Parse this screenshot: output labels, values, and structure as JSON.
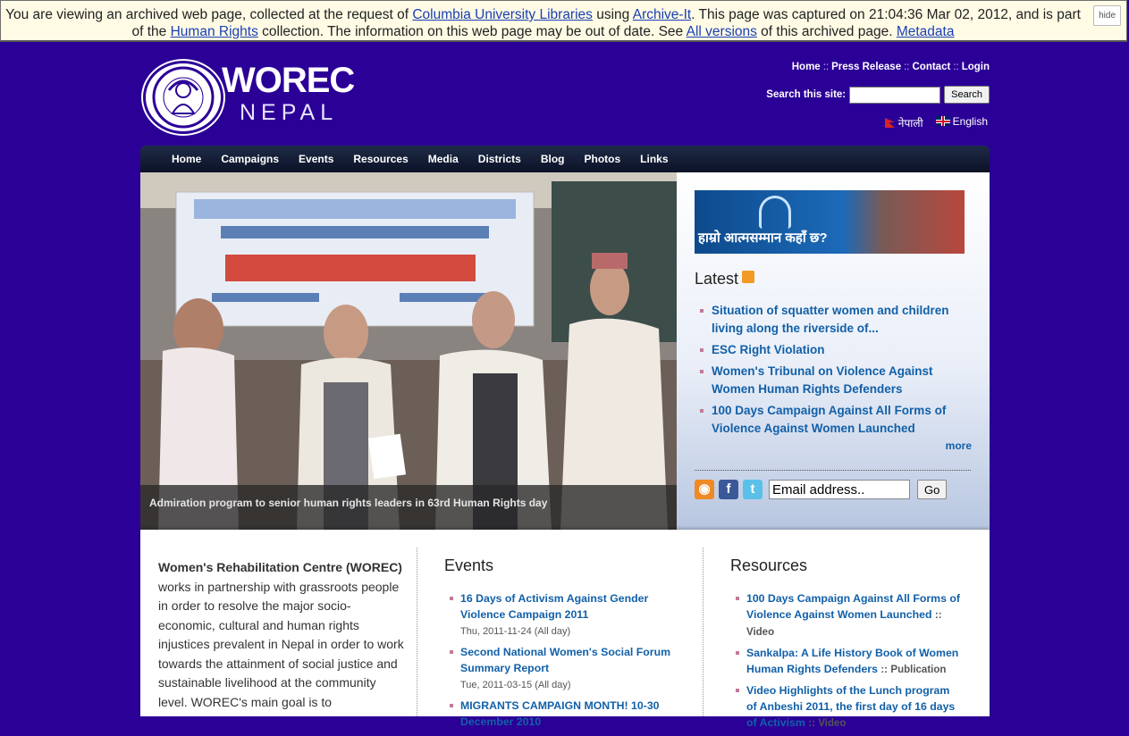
{
  "archive_bar": {
    "t1": "You are viewing an archived web page, collected at the request of ",
    "link1": "Columbia University Libraries",
    "t2": " using ",
    "link2": "Archive-It",
    "t3": ". This page was captured on 21:04:36 Mar 02, 2012, and is part",
    "t4": "of the ",
    "link3": "Human Rights",
    "t5": " collection. The information on this web page may be out of date. See ",
    "link4": "All versions",
    "t6": " of this archived page. ",
    "link5": "Metadata",
    "hide": "hide"
  },
  "logo": {
    "name": "WOREC",
    "sub": "NEPAL"
  },
  "top_links": [
    "Home",
    "Press Release",
    "Contact",
    "Login"
  ],
  "search": {
    "label": "Search this site:",
    "button": "Search",
    "value": ""
  },
  "languages": [
    "नेपाली",
    "English"
  ],
  "nav": [
    "Home",
    "Campaigns",
    "Events",
    "Resources",
    "Media",
    "Districts",
    "Blog",
    "Photos",
    "Links"
  ],
  "hero": {
    "caption": "Admiration program to senior human rights leaders in 63rd Human Rights day"
  },
  "side": {
    "banner_text": "हाम्रो आत्मसम्मान कहाँ छ?",
    "latest_title": "Latest",
    "latest": [
      "Situation of squatter women and children living along the riverside of...",
      "ESC Right Violation",
      "Women's Tribunal on Violence Against Women Human Rights Defenders",
      "100 Days Campaign Against All Forms of Violence Against Women Launched"
    ],
    "more": "more",
    "email_placeholder": "Email address..",
    "go": "Go"
  },
  "intro": {
    "bold": "Women's Rehabilitation Centre (WOREC)",
    "text": " works in partnership with grassroots people in order to resolve the major socio-economic, cultural and human rights injustices prevalent in Nepal in order to work towards the attainment of social justice and sustainable livelihood at the community level. WOREC's main goal is to"
  },
  "events": {
    "title": "Events",
    "items": [
      {
        "title": "16 Days of Activism Against Gender Violence Campaign 2011",
        "date": "Thu, 2011-11-24",
        "allday": "(All day)"
      },
      {
        "title": "Second National Women's Social Forum Summary Report",
        "date": "Tue, 2011-03-15",
        "allday": "(All day)"
      },
      {
        "title": "MIGRANTS CAMPAIGN MONTH! 10-30 December 2010",
        "date": "",
        "allday": ""
      }
    ]
  },
  "resources": {
    "title": "Resources",
    "items": [
      {
        "title": "100 Days Campaign Against All Forms of Violence Against Women Launched",
        "cat": "Video"
      },
      {
        "title": "Sankalpa: A Life History Book of Women Human Rights Defenders",
        "cat": "Publication"
      },
      {
        "title": "Video Highlights of the Lunch program of Anbeshi 2011, the first day of 16 days of Activism",
        "cat": "Video"
      }
    ]
  }
}
